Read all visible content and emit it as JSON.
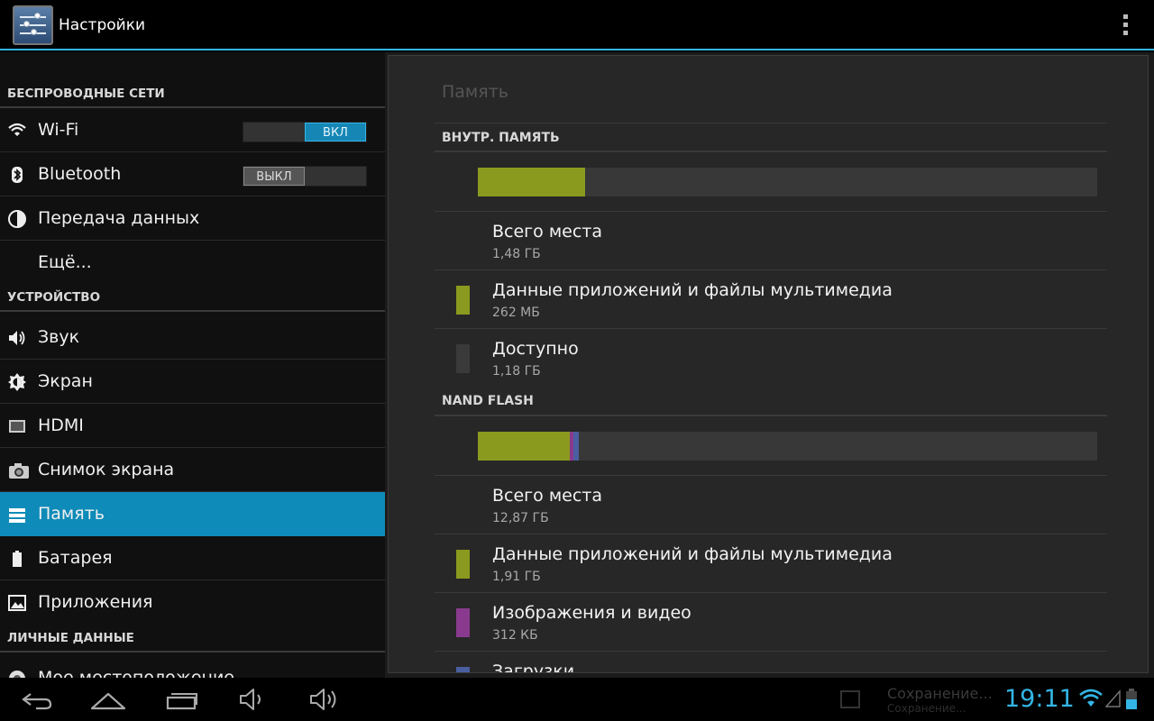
{
  "actionbar": {
    "title": "Настройки",
    "icon": "settings-sliders-icon",
    "overflow_icon": "overflow-menu-icon"
  },
  "left": {
    "sections": [
      {
        "label": "БЕСПРОВОДНЫЕ СЕТИ"
      },
      {
        "label": "УСТРОЙСТВО"
      },
      {
        "label": "ЛИЧНЫЕ ДАННЫЕ"
      }
    ],
    "items": [
      {
        "label": "Wi-Fi",
        "icon": "wifi-icon",
        "toggle": "ВКЛ"
      },
      {
        "label": "Bluetooth",
        "icon": "bluetooth-icon",
        "toggle": "ВЫКЛ"
      },
      {
        "label": "Передача данных",
        "icon": "data-usage-icon"
      },
      {
        "label": "Ещё..."
      },
      {
        "label": "Звук",
        "icon": "speaker-icon"
      },
      {
        "label": "Экран",
        "icon": "brightness-icon"
      },
      {
        "label": "HDMI",
        "icon": "hdmi-icon"
      },
      {
        "label": "Снимок экрана",
        "icon": "camera-icon"
      },
      {
        "label": "Память",
        "icon": "storage-icon",
        "selected": true
      },
      {
        "label": "Батарея",
        "icon": "battery-icon"
      },
      {
        "label": "Приложения",
        "icon": "apps-icon"
      },
      {
        "label": "Мое местоположение",
        "icon": "location-icon"
      }
    ]
  },
  "right": {
    "title": "Память",
    "internal": {
      "header": "ВНУТР. ПАМЯТЬ",
      "usage_fraction": {
        "apps": 0.173
      },
      "rows": [
        {
          "title": "Всего места",
          "value": "1,48 ГБ"
        },
        {
          "title": "Данные приложений и файлы мультимедиа",
          "value": "262 МБ",
          "color": "#8a9a1e"
        },
        {
          "title": "Доступно",
          "value": "1,18 ГБ",
          "color": "#3a3a3a"
        }
      ]
    },
    "nand": {
      "header": "NAND FLASH",
      "usage_fraction": {
        "apps": 0.148,
        "images": 0.006,
        "downloads": 0.009
      },
      "rows": [
        {
          "title": "Всего места",
          "value": "12,87 ГБ"
        },
        {
          "title": "Данные приложений и файлы мультимедиа",
          "value": "1,91 ГБ",
          "color": "#8a9a1e"
        },
        {
          "title": "Изображения и видео",
          "value": "312 КБ",
          "color": "#8a3a8e"
        },
        {
          "title": "Загрузки",
          "value": "",
          "color": "#4a5fa0"
        }
      ]
    },
    "colors": {
      "apps": "#8a9a1e",
      "images": "#8a3a8e",
      "downloads": "#4a5fa0",
      "free": "#383838"
    }
  },
  "navbar": {
    "buttons": [
      "back-icon",
      "home-icon",
      "recent-apps-icon",
      "volume-down-icon",
      "volume-up-icon"
    ],
    "notification": {
      "title": "Сохранение...",
      "subtitle": "Сохранение..."
    },
    "clock": "19:11"
  }
}
